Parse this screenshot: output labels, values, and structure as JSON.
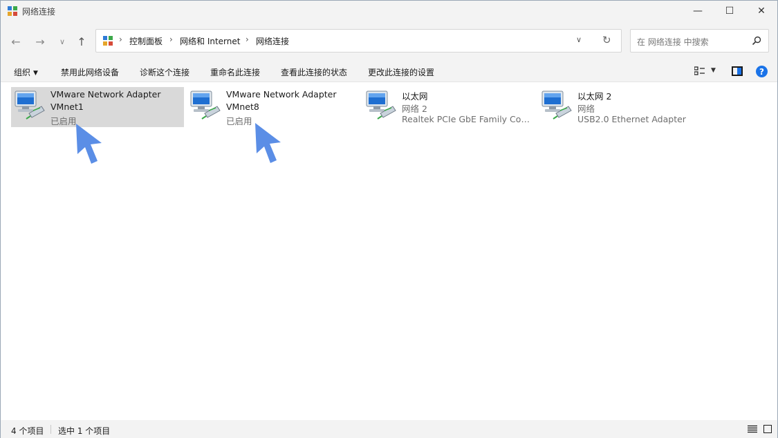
{
  "window": {
    "title": "网络连接",
    "minimize_glyph": "—",
    "maximize_glyph": "☐",
    "close_glyph": "✕"
  },
  "nav": {
    "back_glyph": "←",
    "forward_glyph": "→",
    "recent_glyph": "∨",
    "up_glyph": "↑"
  },
  "address": {
    "crumbs": [
      "控制面板",
      "网络和 Internet",
      "网络连接"
    ],
    "separator": "›",
    "dropdown_glyph": "∨",
    "refresh_glyph": "↻"
  },
  "search": {
    "placeholder": "在 网络连接 中搜索",
    "icon": "search-icon"
  },
  "commands": {
    "organize": "组织",
    "disable_device": "禁用此网络设备",
    "diagnose": "诊断这个连接",
    "rename": "重命名此连接",
    "view_status": "查看此连接的状态",
    "change_settings": "更改此连接的设置",
    "help_glyph": "?"
  },
  "adapters": [
    {
      "name": "VMware Network Adapter",
      "line2": "VMnet1",
      "line3": "已启用",
      "selected": true
    },
    {
      "name": "VMware Network Adapter",
      "line2": "VMnet8",
      "line3": "已启用",
      "selected": false
    },
    {
      "name": "以太网",
      "line2": "网络 2",
      "line3": "Realtek PCIe GbE Family Contr...",
      "selected": false
    },
    {
      "name": "以太网 2",
      "line2": "网络",
      "line3": "USB2.0 Ethernet Adapter",
      "selected": false
    }
  ],
  "status": {
    "item_count": "4 个项目",
    "selected_count": "选中 1 个项目"
  },
  "colors": {
    "accent": "#1a73e8",
    "cursor": "#5b8ee6",
    "selection": "#d9d9d9",
    "chrome": "#f3f3f3"
  }
}
